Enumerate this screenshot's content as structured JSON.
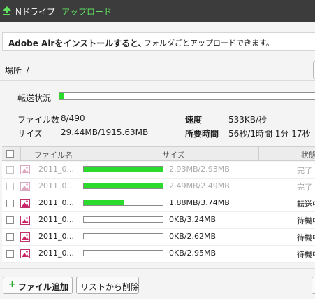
{
  "header": {
    "app_title": "Nドライブ",
    "page_title": "アップロード",
    "logo_icon": "upload-arrow-icon"
  },
  "notice": {
    "text_bold": "Adobe Airをインストールすると、",
    "text": "フォルダごとアップロードできます。"
  },
  "location": {
    "label": "場所",
    "value": "/"
  },
  "transfer": {
    "label": "転送状況",
    "progress_fraction": 0.016,
    "files_label": "ファイル数",
    "files_value": "8/490",
    "size_label": "サイズ",
    "size_value": "29.44MB/1915.63MB",
    "speed_label": "速度",
    "speed_value": "533KB/秒",
    "time_label": "所要時間",
    "time_value": "56秒/1時間 1分 17秒"
  },
  "table": {
    "columns": {
      "name": "ファイル名",
      "size": "サイズ",
      "state": "状態"
    },
    "rows": [
      {
        "name": "2011_0...",
        "progress": 1.0,
        "size": "2.93MB/2.93MB",
        "state": "完了",
        "done": true
      },
      {
        "name": "2011_0...",
        "progress": 1.0,
        "size": "2.49MB/2.49MB",
        "state": "完了",
        "done": true
      },
      {
        "name": "2011_0...",
        "progress": 0.5,
        "size": "1.88MB/3.74MB",
        "state": "転送中",
        "done": false
      },
      {
        "name": "2011_0...",
        "progress": 0.0,
        "size": "0KB/3.24MB",
        "state": "待機中",
        "done": false
      },
      {
        "name": "2011_0...",
        "progress": 0.0,
        "size": "0KB/2.62MB",
        "state": "待機中",
        "done": false
      },
      {
        "name": "2011_0...",
        "progress": 0.0,
        "size": "0KB/2.95MB",
        "state": "待機中",
        "done": false
      }
    ]
  },
  "footer": {
    "add_icon": "+",
    "add_label": "ファイル追加",
    "remove_label": "リストから削除"
  },
  "colors": {
    "header_bg": "#3c3c3c",
    "accent_green": "#5fe05f",
    "progress_green": "#2bdb2b"
  }
}
